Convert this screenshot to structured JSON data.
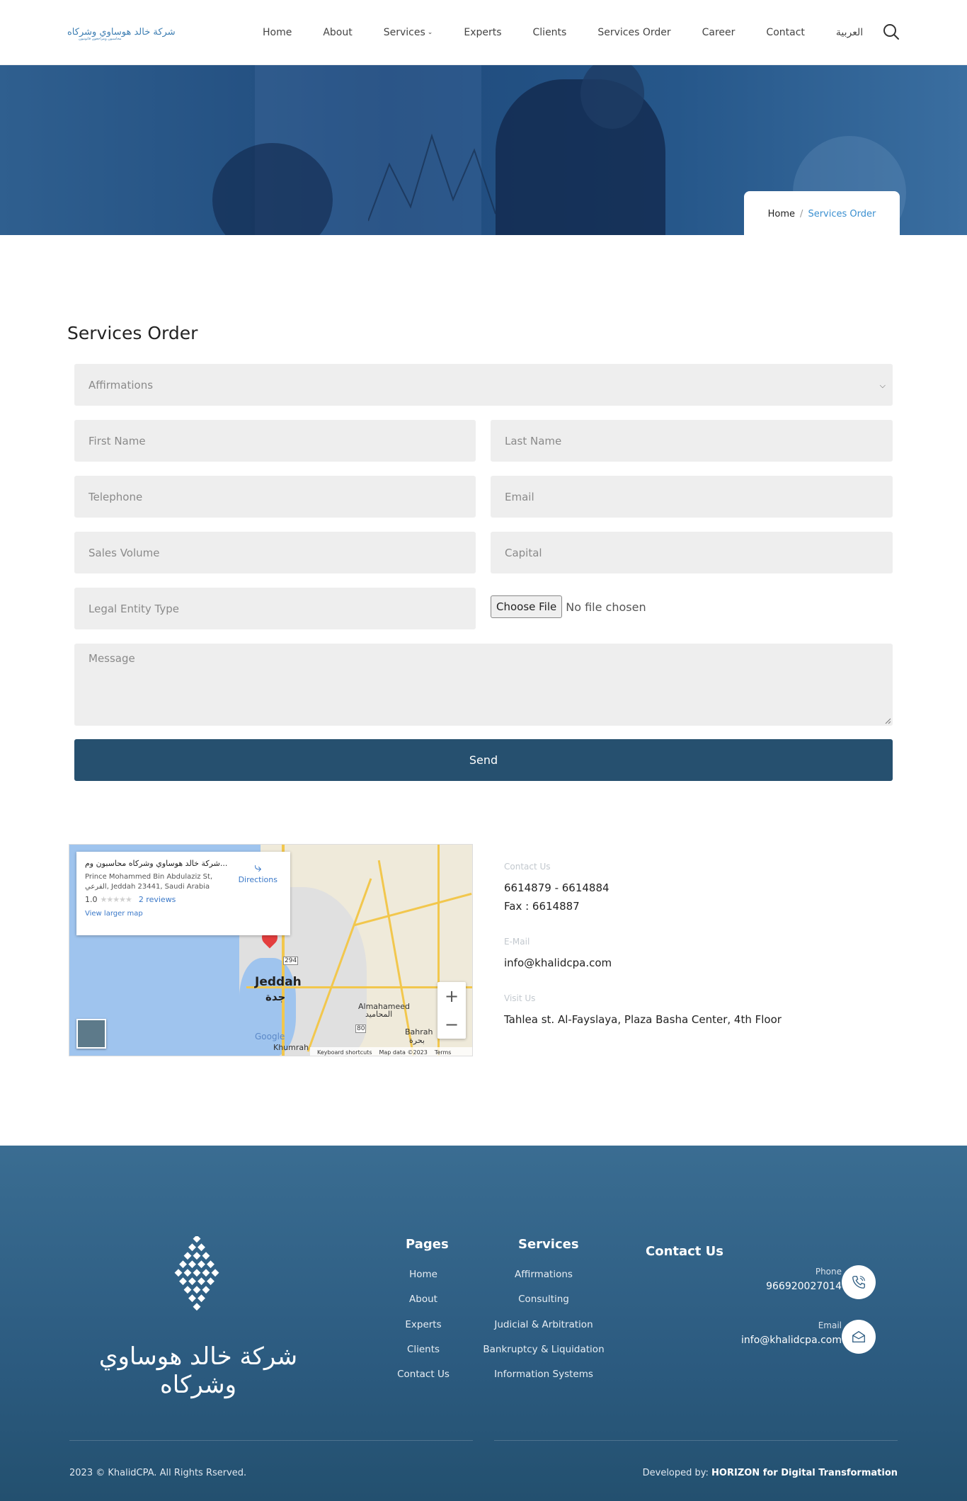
{
  "header": {
    "logo_text": "شركة خالد هوساوي وشركاه",
    "logo_sub": "محاسبون ومراجعون قانونيون",
    "nav": [
      "Home",
      "About",
      "Services",
      "Experts",
      "Clients",
      "Services Order",
      "Career",
      "Contact",
      "العربية"
    ]
  },
  "hero": {
    "breadcrumb_home": "Home",
    "breadcrumb_sep": "/",
    "breadcrumb_current": "Services Order"
  },
  "form": {
    "title": "Services Order",
    "service_select_value": "Affirmations",
    "first_name_placeholder": "First Name",
    "last_name_placeholder": "Last Name",
    "telephone_placeholder": "Telephone",
    "email_placeholder": "Email",
    "sales_volume_placeholder": "Sales Volume",
    "capital_placeholder": "Capital",
    "legal_entity_placeholder": "Legal Entity Type",
    "file_button": "Choose File",
    "file_status": "No file chosen",
    "message_placeholder": "Message",
    "send_label": "Send"
  },
  "map": {
    "place_title": "شركة خالد هوساوي وشركاه محاسبون وم...",
    "address": "Prince Mohammed Bin Abdulaziz St, الفرعي, Jeddah 23441, Saudi Arabia",
    "rating": "1.0",
    "stars": "★★★★★",
    "reviews": "2 reviews",
    "view_larger": "View larger map",
    "directions": "Directions",
    "city": "Jeddah",
    "city_ar": "جدة",
    "label_almahameed": "Almahameed",
    "label_almahameed_ar": "المحاميد",
    "label_bahrah": "Bahrah",
    "label_bahrah_ar": "بحرة",
    "label_khumrah": "Khumrah",
    "road_294": "294",
    "road_80": "80",
    "google": "Google",
    "keyboard": "Keyboard shortcuts",
    "map_data": "Map data ©2023",
    "terms": "Terms",
    "zoom_in": "+",
    "zoom_out": "−"
  },
  "contact": {
    "contact_label": "Contact Us",
    "phones": "6614879 - 6614884",
    "fax": "Fax : 6614887",
    "email_label": "E-Mail",
    "email": "info@khalidcpa.com",
    "visit_label": "Visit Us",
    "address": "Tahlea st. Al-Fayslaya, Plaza Basha Center, 4th Floor"
  },
  "footer": {
    "logo_text": "شركة خالد هوساوي وشركاه",
    "pages_title": "Pages",
    "pages": [
      "Home",
      "About",
      "Experts",
      "Clients",
      "Contact Us"
    ],
    "services_title": "Services",
    "services": [
      "Affirmations",
      "Consulting",
      "Judicial & Arbitration",
      "Bankruptcy & Liquidation",
      "Information Systems"
    ],
    "contact_title": "Contact Us",
    "phone_label": "Phone",
    "phone": "966920027014",
    "email_label": "Email",
    "email": "info@khalidcpa.com",
    "copyright": "2023 © KhalidCPA. All Rights Rserved.",
    "developed_by": "Developed by:",
    "developer": "HORIZON for Digital Transformation"
  },
  "colors": {
    "primary": "#26506f",
    "accent": "#3a8fd0",
    "field_bg": "#eeeeee"
  }
}
